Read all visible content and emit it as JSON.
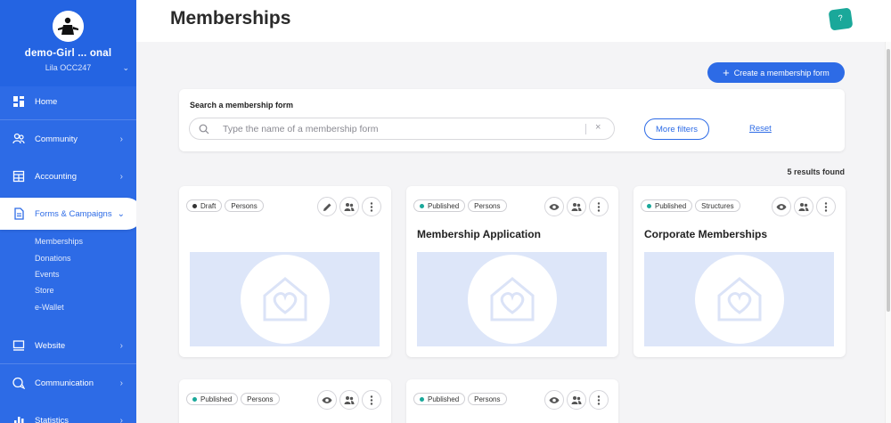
{
  "colors": {
    "primary": "#2d6be6",
    "help": "#1aa89a",
    "published": "#1aa89a",
    "draft": "#333333",
    "placeholder_bg": "#dde6f9"
  },
  "sidebar": {
    "org_name": "demo-Girl ... onal",
    "org_sub": "Lila OCC247",
    "items": [
      {
        "label": "Home",
        "icon": "dashboard-icon"
      },
      {
        "label": "Community",
        "icon": "users-icon"
      },
      {
        "label": "Accounting",
        "icon": "calculator-icon"
      },
      {
        "label": "Forms & Campaigns",
        "icon": "document-icon"
      },
      {
        "label": "Website",
        "icon": "monitor-icon"
      },
      {
        "label": "Communication",
        "icon": "chat-icon"
      },
      {
        "label": "Statistics",
        "icon": "chart-icon"
      }
    ],
    "sub_items": [
      "Memberships",
      "Donations",
      "Events",
      "Store",
      "e-Wallet"
    ]
  },
  "header": {
    "title": "Memberships",
    "help_label": "?"
  },
  "main": {
    "create_button": "Create a membership form",
    "search": {
      "label": "Search a membership form",
      "placeholder": "Type the name of a membership form",
      "value": ""
    },
    "more_filters": "More filters",
    "reset": "Reset",
    "results_count": "5 results found",
    "cards": [
      {
        "status": "Draft",
        "type": "Persons",
        "title": ""
      },
      {
        "status": "Published",
        "type": "Persons",
        "title": "Membership Application"
      },
      {
        "status": "Published",
        "type": "Structures",
        "title": "Corporate Memberships"
      },
      {
        "status": "Published",
        "type": "Persons",
        "title": ""
      },
      {
        "status": "Published",
        "type": "Persons",
        "title": ""
      }
    ]
  }
}
